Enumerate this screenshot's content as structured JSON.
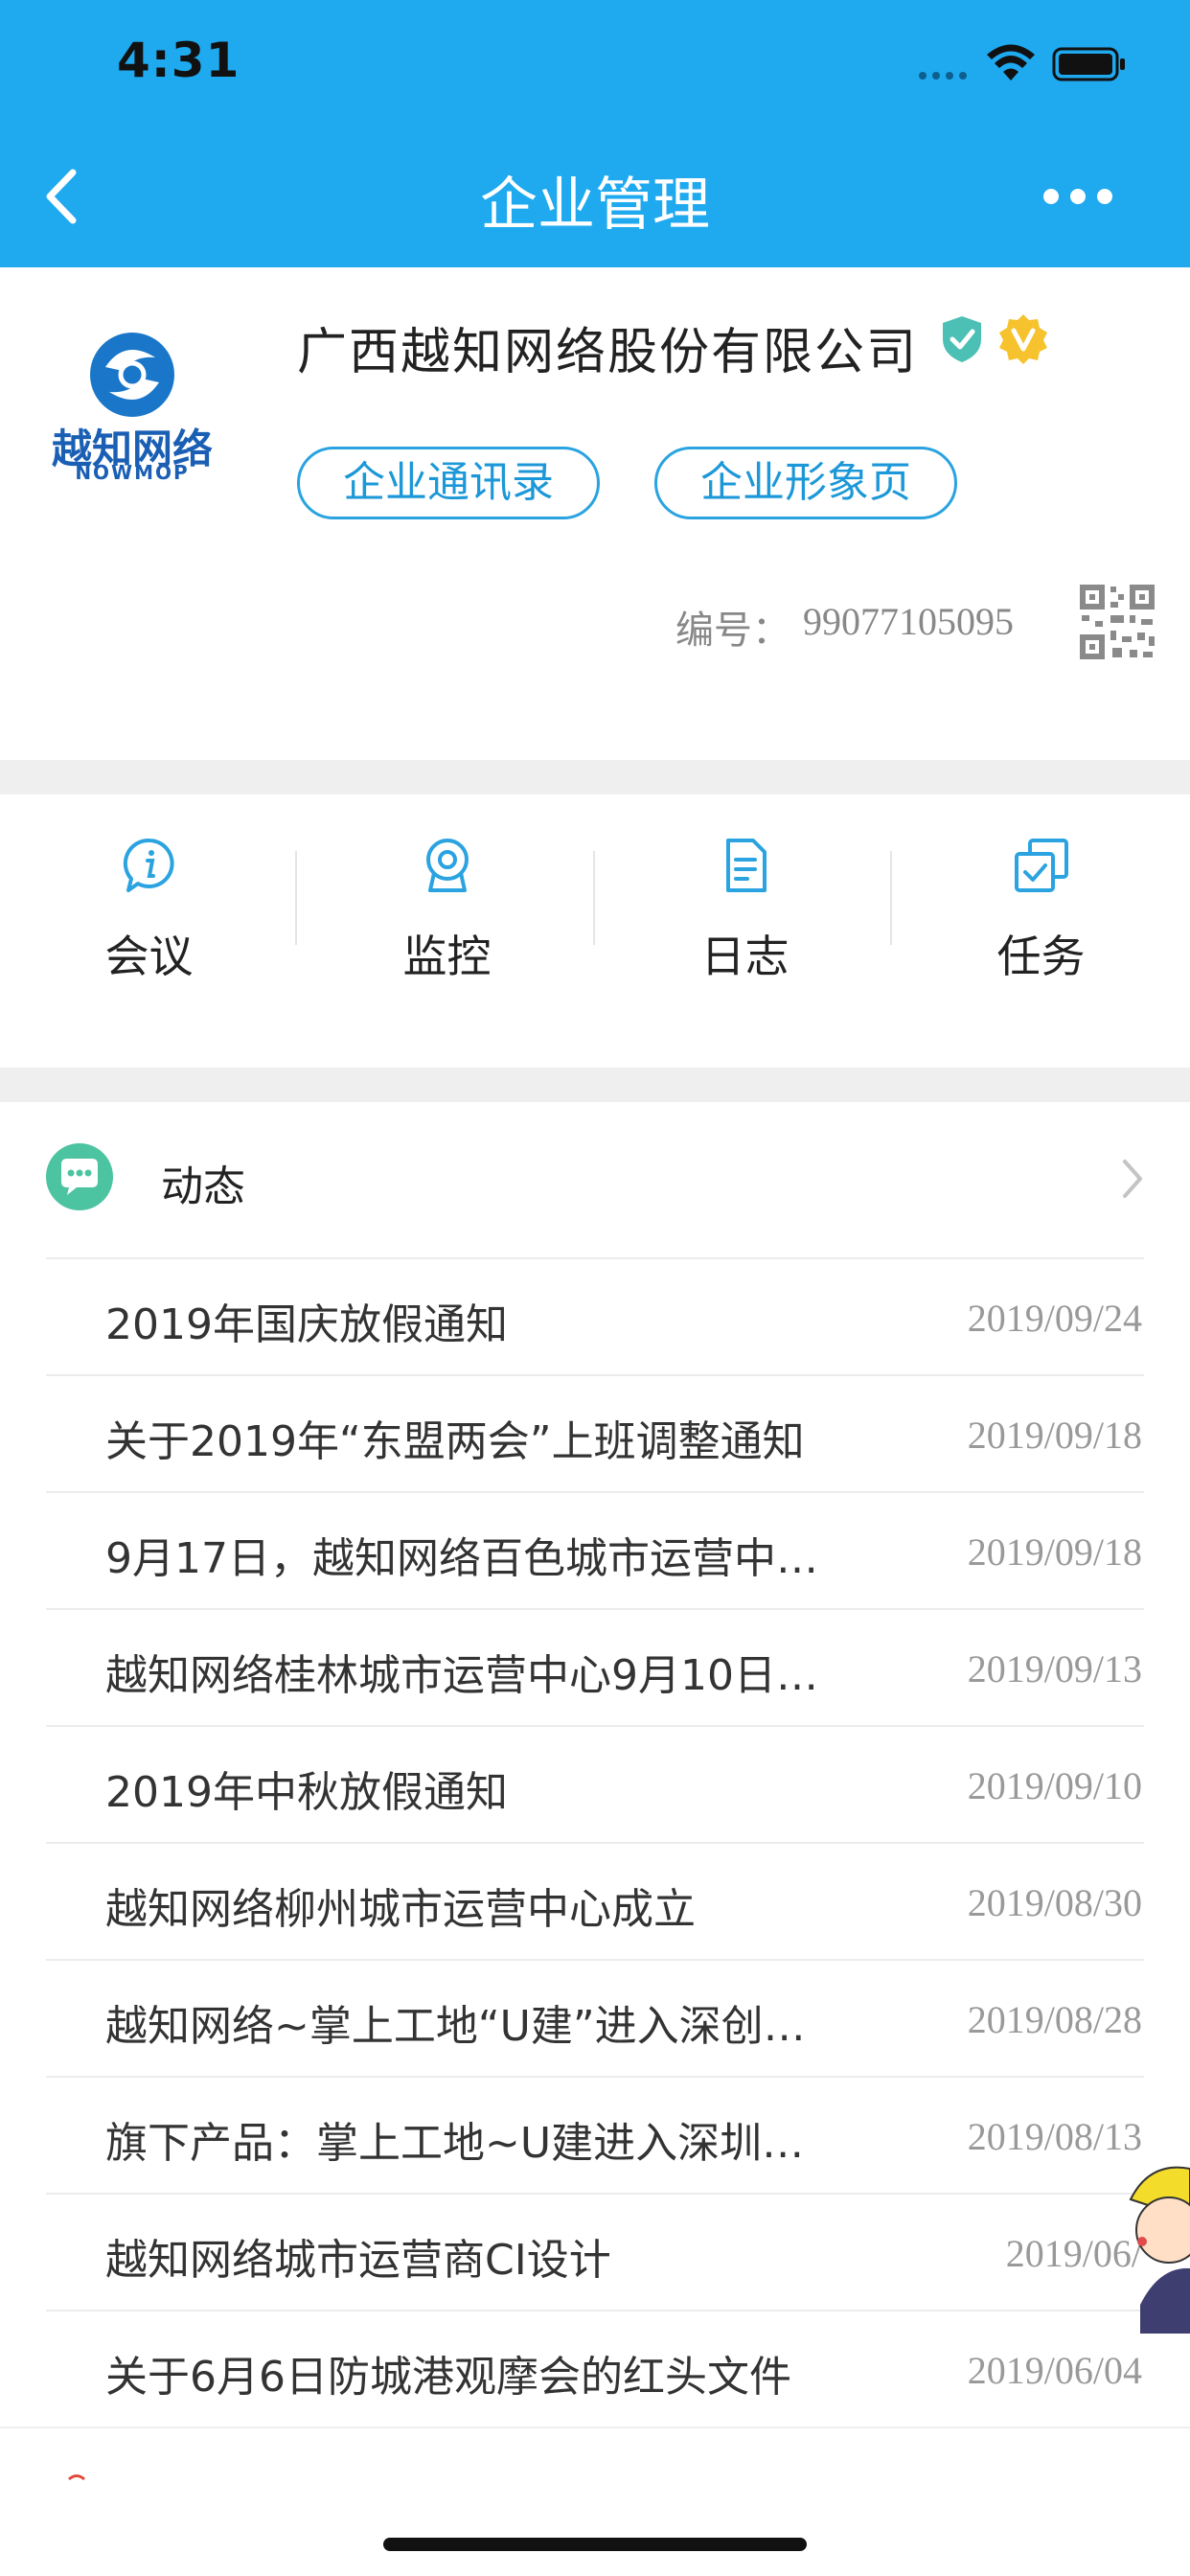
{
  "status_bar": {
    "time": "4:31"
  },
  "nav": {
    "title": "企业管理"
  },
  "company": {
    "name": "广西越知网络股份有限公司",
    "logo_text": "越知网络",
    "logo_subtext": "NOWMOP",
    "contacts_button": "企业通讯录",
    "profile_button": "企业形象页",
    "code_label": "编号：",
    "code_value": "99077105095"
  },
  "quick_actions": [
    {
      "label": "会议",
      "icon": "meeting-info-icon"
    },
    {
      "label": "监控",
      "icon": "camera-icon"
    },
    {
      "label": "日志",
      "icon": "log-document-icon"
    },
    {
      "label": "任务",
      "icon": "task-check-icon"
    }
  ],
  "news": {
    "title": "动态",
    "items": [
      {
        "title": "2019年国庆放假通知",
        "date": "2019/09/24"
      },
      {
        "title": "关于2019年“东盟两会”上班调整通知",
        "date": "2019/09/18"
      },
      {
        "title": "9月17日，越知网络百色城市运营中…",
        "date": "2019/09/18"
      },
      {
        "title": "越知网络桂林城市运营中心9月10日…",
        "date": "2019/09/13"
      },
      {
        "title": "2019年中秋放假通知",
        "date": "2019/09/10"
      },
      {
        "title": "越知网络柳州城市运营中心成立",
        "date": "2019/08/30"
      },
      {
        "title": "越知网络~掌上工地“U建”进入深创…",
        "date": "2019/08/28"
      },
      {
        "title": "旗下产品：掌上工地~U建进入深圳…",
        "date": "2019/08/13"
      },
      {
        "title": "越知网络城市运营商CI设计",
        "date": "2019/06/"
      },
      {
        "title": "关于6月6日防城港观摩会的红头文件",
        "date": "2019/06/04"
      }
    ]
  },
  "colors": {
    "header": "#1fa9ef",
    "accent": "#2aa3e0",
    "news_icon": "#4cc3a1"
  }
}
